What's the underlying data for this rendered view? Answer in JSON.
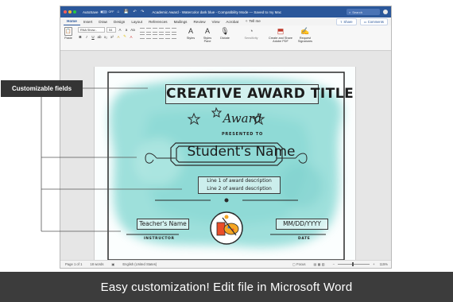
{
  "window": {
    "autosave_label": "AutoSave",
    "autosave_state": "OFF",
    "title": "Academic Award - Watercolor dark blue - Compatibility Mode — Saved to my Mac",
    "search_placeholder": "Search",
    "brand_color": "#2b579a"
  },
  "tabs": [
    "Home",
    "Insert",
    "Draw",
    "Design",
    "Layout",
    "References",
    "Mailings",
    "Review",
    "View",
    "Acrobat",
    "Tell me"
  ],
  "active_tab": "Home",
  "tabs_right": {
    "share": "Share",
    "comments": "Comments"
  },
  "ribbon": {
    "paste": "Paste",
    "font_name": "RNA Show...",
    "font_size": "54",
    "styles": "Styles",
    "styles_pane": "Styles Pane",
    "dictate": "Dictate",
    "sensitivity": "Sensitivity",
    "create_share": "Create and Share Adobe PDF",
    "request_sig": "Request Signatures"
  },
  "certificate": {
    "title": "CREATIVE AWARD TITLE",
    "award": "Award",
    "presented_to": "PRESENTED TO",
    "student_name": "Student's Name",
    "desc_line1": "Line 1 of award description",
    "desc_line2": "Line 2 of award description",
    "teacher_name": "Teacher's Name",
    "date_field": "MM/DD/YYYY",
    "instructor_label": "INSTRUCTOR",
    "date_label": "DATE",
    "wash_color": "#7fd6d0"
  },
  "statusbar": {
    "page": "Page 1 of 1",
    "words": "18 words",
    "language": "English (United States)",
    "focus": "Focus",
    "zoom": "115%"
  },
  "callout": {
    "label": "Customizable fields"
  },
  "banner": {
    "text": "Easy customization! Edit file in Microsoft Word"
  }
}
